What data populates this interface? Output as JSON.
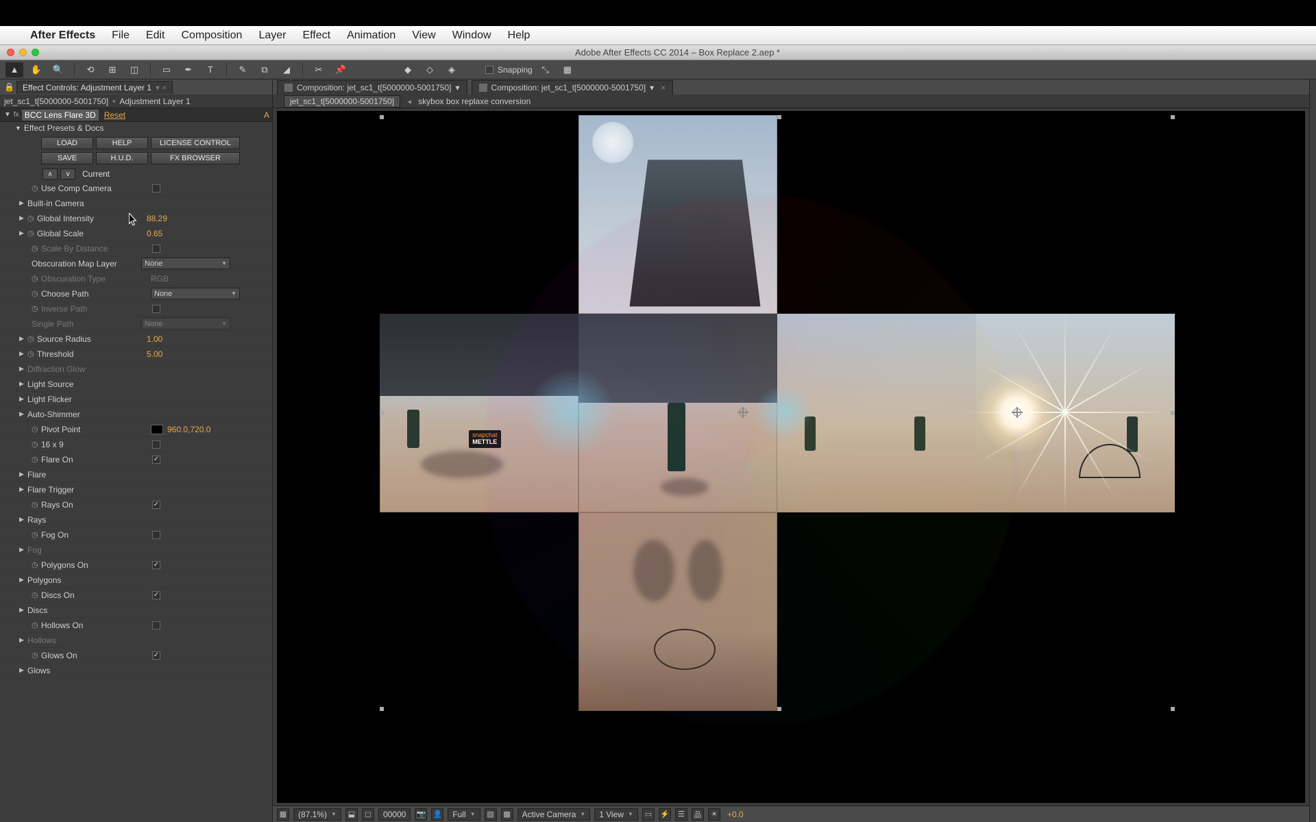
{
  "menubar": {
    "app": "After Effects",
    "items": [
      "File",
      "Edit",
      "Composition",
      "Layer",
      "Effect",
      "Animation",
      "View",
      "Window",
      "Help"
    ]
  },
  "titlebar": "Adobe After Effects CC 2014 – Box Replace 2.aep *",
  "toolbar": {
    "snapping_label": "Snapping"
  },
  "effect_controls": {
    "panel_title": "Effect Controls: Adjustment Layer 1",
    "breadcrumb_a": "jet_sc1_t[5000000-5001750]",
    "breadcrumb_b": "Adjustment Layer 1",
    "fx_name": "BCC Lens Flare 3D",
    "reset": "Reset",
    "about": "A",
    "presets_header": "Effect Presets & Docs",
    "btn_load": "LOAD",
    "btn_help": "HELP",
    "btn_license": "LICENSE CONTROL",
    "btn_save": "SAVE",
    "btn_hud": "H.U.D.",
    "btn_fxbrowser": "FX BROWSER",
    "current": "Current"
  },
  "params": {
    "use_comp_camera": "Use Comp Camera",
    "builtin_camera": "Built-in Camera",
    "global_intensity": "Global Intensity",
    "global_intensity_v": "88.29",
    "global_scale": "Global Scale",
    "global_scale_v": "0.65",
    "scale_by_distance": "Scale By Distance",
    "obscuration_map": "Obscuration Map Layer",
    "none": "None",
    "obscuration_type": "Obscuration Type",
    "rgb": "RGB",
    "choose_path": "Choose Path",
    "inverse_path": "Inverse Path",
    "single_path": "Single Path",
    "source_radius": "Source Radius",
    "source_radius_v": "1.00",
    "threshold": "Threshold",
    "threshold_v": "5.00",
    "diffraction_glow": "Diffraction Glow",
    "light_source": "Light Source",
    "light_flicker": "Light Flicker",
    "auto_shimmer": "Auto-Shimmer",
    "pivot_point": "Pivot Point",
    "pivot_point_v": "960.0,720.0",
    "sixteen_nine": "16 x 9",
    "flare_on": "Flare On",
    "flare": "Flare",
    "flare_trigger": "Flare Trigger",
    "rays_on": "Rays On",
    "rays": "Rays",
    "fog_on": "Fog On",
    "fog": "Fog",
    "polygons_on": "Polygons On",
    "polygons": "Polygons",
    "discs_on": "Discs On",
    "discs": "Discs",
    "hollows_on": "Hollows On",
    "hollows": "Hollows",
    "glows_on": "Glows On",
    "glows": "Glows"
  },
  "comp_tabs": {
    "tab1": "Composition: jet_sc1_t[5000000-5001750]",
    "tab2": "Composition: jet_sc1_t[5000000-5001750]"
  },
  "comp_breadcrumb": {
    "a": "jet_sc1_t[5000000-5001750]",
    "b": "skybox box replaxe conversion"
  },
  "sign": {
    "line1": "snapchat",
    "line2": "METTLE"
  },
  "viewer_footer": {
    "zoom": "(87.1%)",
    "frame": "00000",
    "res": "Full",
    "camera": "Active Camera",
    "views": "1 View",
    "exposure": "+0.0"
  }
}
